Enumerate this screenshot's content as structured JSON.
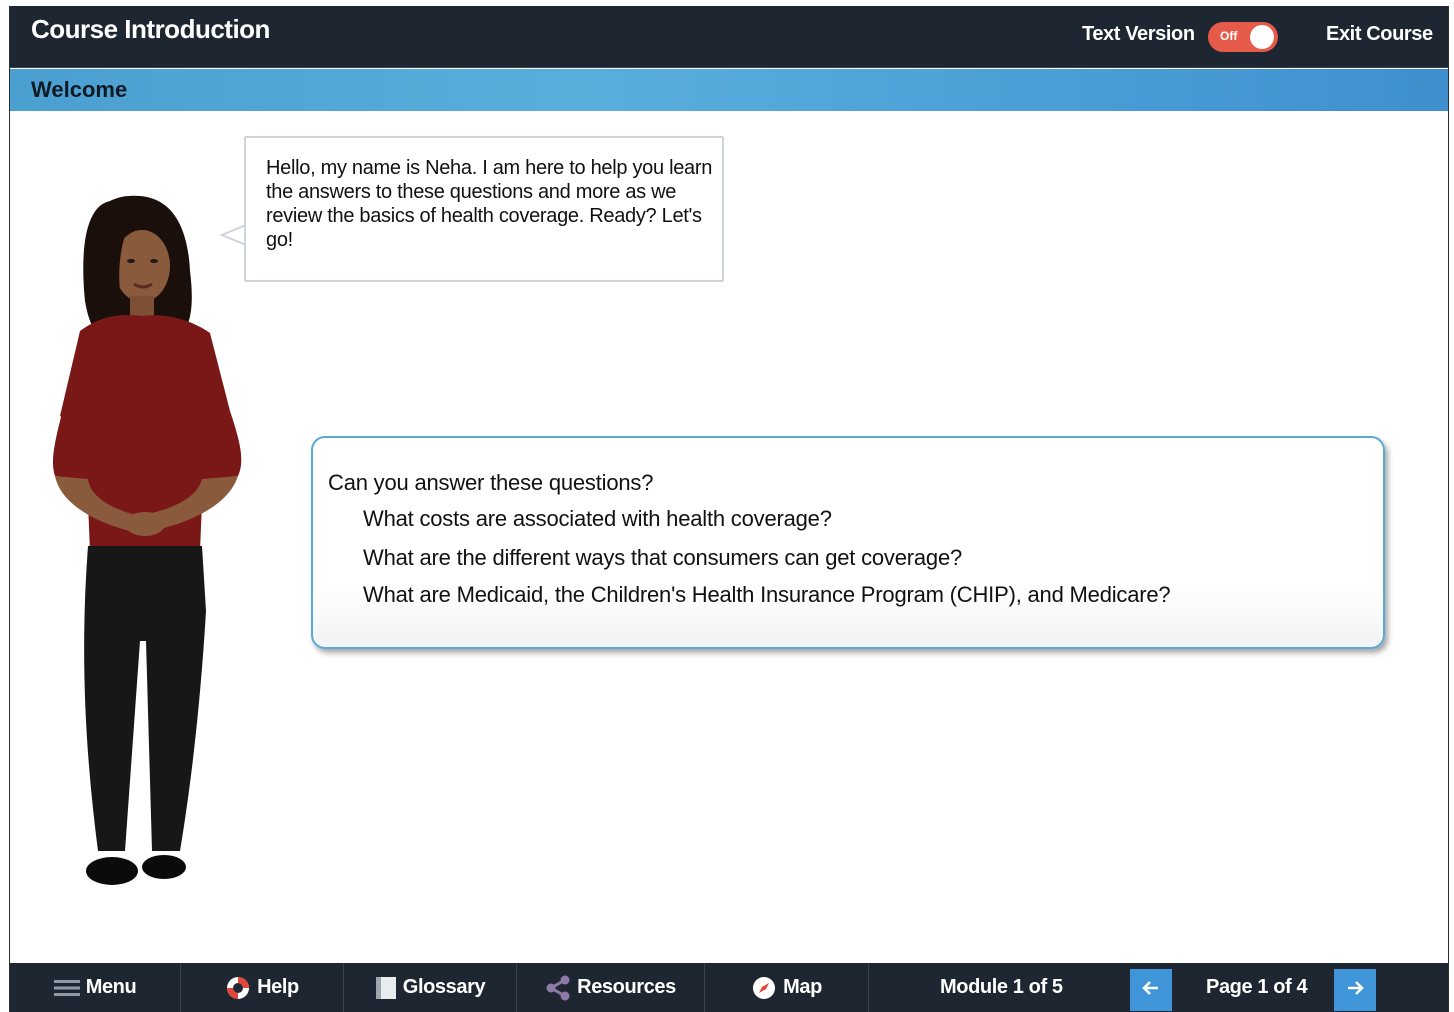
{
  "header": {
    "course_title": "Course Introduction",
    "text_version_label": "Text Version",
    "toggle_state": "Off",
    "exit_label": "Exit Course"
  },
  "section": {
    "title": "Welcome"
  },
  "bubble": {
    "text": "Hello, my name is Neha. I am here to help you learn the answers to these questions and more as we review the basics of health coverage. Ready? Let's go!"
  },
  "questions": {
    "title": "Can you answer these questions?",
    "items": [
      "What costs are associated with health coverage?",
      "What are the different ways that consumers can get coverage?",
      "What are Medicaid, the Children's Health Insurance Program (CHIP), and Medicare?"
    ]
  },
  "footer": {
    "menu_label": "Menu",
    "help_label": "Help",
    "glossary_label": "Glossary",
    "resources_label": "Resources",
    "map_label": "Map",
    "module_label": "Module 1 of 5",
    "page_label": "Page 1 of 4"
  },
  "icons": {
    "menu": "hamburger-icon",
    "help": "lifebuoy-icon",
    "glossary": "book-icon",
    "resources": "share-icon",
    "map": "compass-icon",
    "prev": "arrow-left-icon",
    "next": "arrow-right-icon"
  },
  "colors": {
    "topbar": "#1e2731",
    "section_band": "#4a9fd0",
    "toggle_off": "#e65a4a",
    "nav_button": "#3f95d8",
    "card_border": "#5aa9d6"
  }
}
